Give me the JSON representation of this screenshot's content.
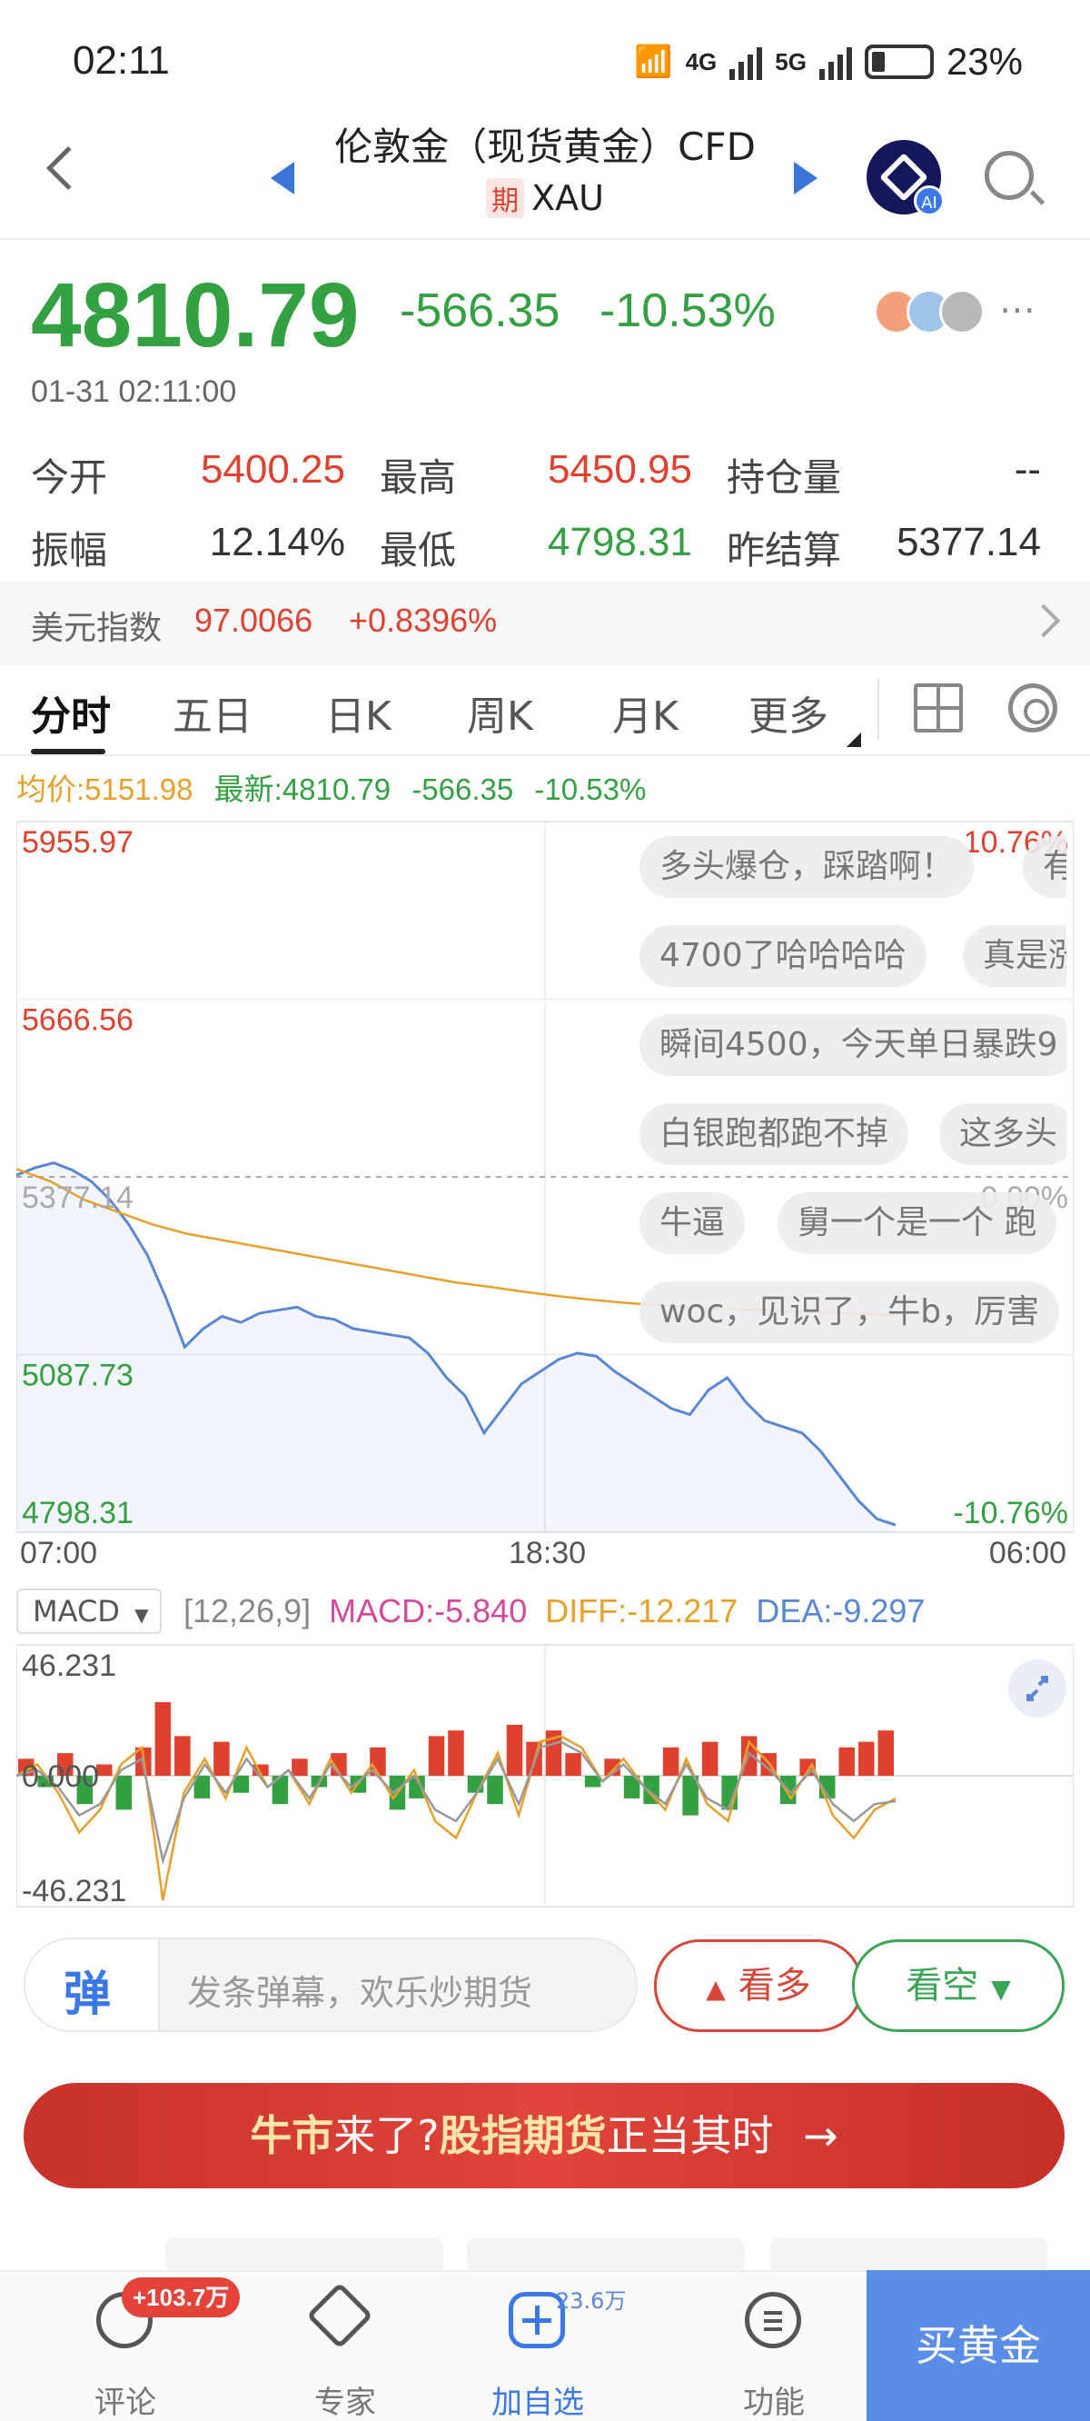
{
  "status_bar": {
    "time": "02:11",
    "net1": "4G",
    "net2": "5G",
    "battery": "23%"
  },
  "header": {
    "title": "伦敦金（现货黄金）CFD",
    "tag": "期",
    "symbol": "XAU"
  },
  "quote": {
    "price": "4810.79",
    "change": "-566.35",
    "change_pct": "-10.53%",
    "timestamp": "01-31 02:11:00",
    "stats": [
      {
        "label": "今开",
        "value": "5400.25",
        "color": "red"
      },
      {
        "label": "最高",
        "value": "5450.95",
        "color": "red"
      },
      {
        "label": "持仓量",
        "value": "--",
        "color": "neutral"
      },
      {
        "label": "振幅",
        "value": "12.14%",
        "color": "neutral"
      },
      {
        "label": "最低",
        "value": "4798.31",
        "color": "green"
      },
      {
        "label": "昨结算",
        "value": "5377.14",
        "color": "neutral"
      }
    ]
  },
  "usd_index": {
    "label": "美元指数",
    "value": "97.0066",
    "change": "+0.8396%"
  },
  "tabs": [
    "分时",
    "五日",
    "日K",
    "周K",
    "月K",
    "更多"
  ],
  "info_line": {
    "avg": "均价:5151.98",
    "latest": "最新:4810.79",
    "change": "-566.35",
    "pct": "-10.53%"
  },
  "chart_data": [
    {
      "type": "line",
      "title": "",
      "y_labels": [
        "5955.97",
        "5666.56",
        "5377.14",
        "5087.73",
        "4798.31"
      ],
      "y_pct_labels": [
        "10.76%",
        "0.00%",
        "-10.76%"
      ],
      "x_labels": [
        "07:00",
        "18:30",
        "06:00"
      ],
      "ylim": [
        4798.31,
        5955.97
      ],
      "reference": 5377.14,
      "series": [
        {
          "name": "最新",
          "values": [
            5380,
            5392,
            5400,
            5388,
            5370,
            5340,
            5300,
            5250,
            5180,
            5100,
            5130,
            5150,
            5140,
            5155,
            5160,
            5165,
            5150,
            5145,
            5130,
            5125,
            5120,
            5115,
            5090,
            5050,
            5020,
            4960,
            5000,
            5040,
            5060,
            5080,
            5090,
            5085,
            5060,
            5040,
            5020,
            5000,
            4990,
            5030,
            5050,
            5010,
            4980,
            4970,
            4960,
            4930,
            4890,
            4850,
            4820,
            4810
          ]
        },
        {
          "name": "均价",
          "values": [
            5390,
            5370,
            5340,
            5320,
            5300,
            5285,
            5275,
            5265,
            5255,
            5245,
            5235,
            5225,
            5215,
            5205,
            5198,
            5190,
            5183,
            5177,
            5172,
            5168,
            5165,
            5162,
            5160,
            5158,
            5156,
            5154,
            5152
          ]
        }
      ]
    },
    {
      "type": "bar",
      "title": "MACD",
      "ylim": [
        -46.231,
        46.231
      ],
      "y_labels": [
        "46.231",
        "0.000",
        "-46.231"
      ],
      "series": [
        {
          "name": "MACD",
          "values": [
            6,
            -4,
            8,
            -10,
            4,
            -12,
            10,
            26,
            14,
            -8,
            12,
            -6,
            4,
            -10,
            6,
            -4,
            8,
            -6,
            10,
            -12,
            -8,
            14,
            16,
            -6,
            -10,
            18,
            12,
            16,
            8,
            -4,
            6,
            -8,
            -10,
            10,
            -14,
            12,
            -12,
            14,
            8,
            -10,
            6,
            -8,
            10,
            12,
            16
          ]
        },
        {
          "name": "DIFF",
          "values": [
            0,
            4,
            -6,
            -20,
            -12,
            4,
            10,
            -44,
            -6,
            6,
            -8,
            10,
            -4,
            2,
            -10,
            6,
            -6,
            4,
            -8,
            2,
            -16,
            -22,
            -6,
            8,
            -14,
            12,
            14,
            10,
            -2,
            6,
            -4,
            -12,
            6,
            -10,
            -16,
            12,
            4,
            -8,
            4,
            -14,
            -22,
            -12,
            -8
          ]
        },
        {
          "name": "DEA",
          "values": [
            0,
            2,
            -4,
            -14,
            -10,
            2,
            6,
            -30,
            -8,
            4,
            -6,
            6,
            -4,
            2,
            -8,
            4,
            -4,
            2,
            -6,
            0,
            -12,
            -16,
            -6,
            6,
            -10,
            10,
            12,
            8,
            -2,
            4,
            -4,
            -10,
            4,
            -8,
            -12,
            8,
            2,
            -6,
            2,
            -10,
            -16,
            -10,
            -9
          ]
        }
      ]
    }
  ],
  "danmu": [
    {
      "text": "多头爆仓，踩踏啊！"
    },
    {
      "text": "有"
    },
    {
      "text": "4700了哈哈哈哈"
    },
    {
      "text": "真是涨"
    },
    {
      "text": "瞬间4500，今天单日暴跌9"
    },
    {
      "text": "白银跑都跑不掉"
    },
    {
      "text": "这多头"
    },
    {
      "text": "牛逼"
    },
    {
      "text": "舅一个是一个 跑"
    },
    {
      "text": "woc，见识了，牛b，厉害"
    }
  ],
  "macd": {
    "selector": "MACD",
    "params": "[12,26,9]",
    "macd": "MACD:-5.840",
    "diff": "DIFF:-12.217",
    "dea": "DEA:-9.297"
  },
  "comment_bar": {
    "icon_char": "弹",
    "placeholder": "发条弹幕，欢乐炒期货",
    "bull": "看多",
    "bear": "看空"
  },
  "banner": {
    "a": "牛市",
    "b": "来了?",
    "c": "股指期货",
    "d": "正当其时",
    "arrow": "→"
  },
  "bottom_nav": {
    "comments": "评论",
    "comments_badge": "+103.7万",
    "expert": "专家",
    "add": "加自选",
    "add_count": "23.6万",
    "function": "功能",
    "buy": "买黄金"
  },
  "colors": {
    "up": "#e0412f",
    "down": "#33a041",
    "avg_line": "#e8a02a",
    "price_line": "#5a86d6",
    "accent": "#3b78e7"
  }
}
